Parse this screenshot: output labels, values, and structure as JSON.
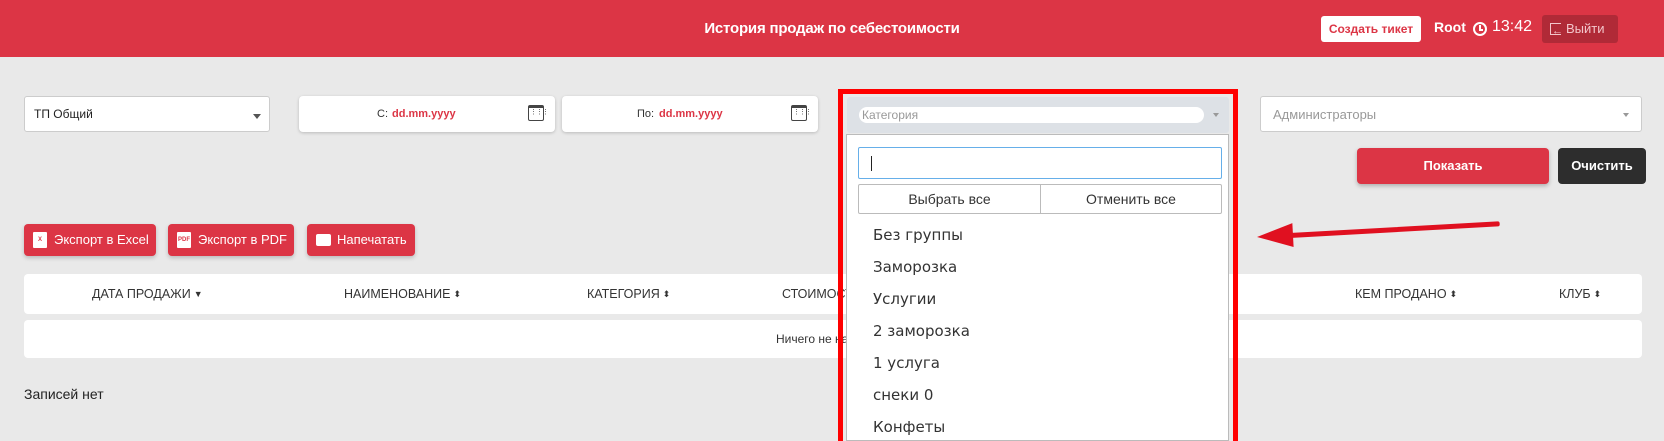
{
  "header": {
    "title": "История продаж по себестоимости",
    "ticket_button": "Создать тикет",
    "user": "Root",
    "time": "13:42",
    "logout_button": "Выйти",
    "accent_color": "#dc3545"
  },
  "filters": {
    "club_select": "ТП Общий",
    "date_from_label": "С:",
    "date_from_value": "dd.mm.yyyy",
    "date_to_label": "По:",
    "date_to_value": "dd.mm.yyyy",
    "category_placeholder": "Категория",
    "admins_placeholder": "Администраторы",
    "show_button": "Показать",
    "clear_button": "Очистить"
  },
  "export": {
    "excel": "Экспорт в Excel",
    "pdf": "Экспорт в PDF",
    "print": "Напечатать"
  },
  "table": {
    "columns": [
      "ДАТА ПРОДАЖИ",
      "НАИМЕНОВАНИЕ",
      "КАТЕГОРИЯ",
      "СТОИМОСТЬ",
      "КЕМ ПРОДАНО",
      "КЛУБ"
    ],
    "empty_message": "Ничего не найдено"
  },
  "no_records": "Записей нет",
  "category_dropdown": {
    "search_value": "",
    "select_all": "Выбрать все",
    "deselect_all": "Отменить все",
    "items": [
      "Без группы",
      "Заморозка",
      "Услугии",
      "2 заморозка",
      "1 услуга",
      "снеки 0",
      "Конфеты"
    ]
  }
}
